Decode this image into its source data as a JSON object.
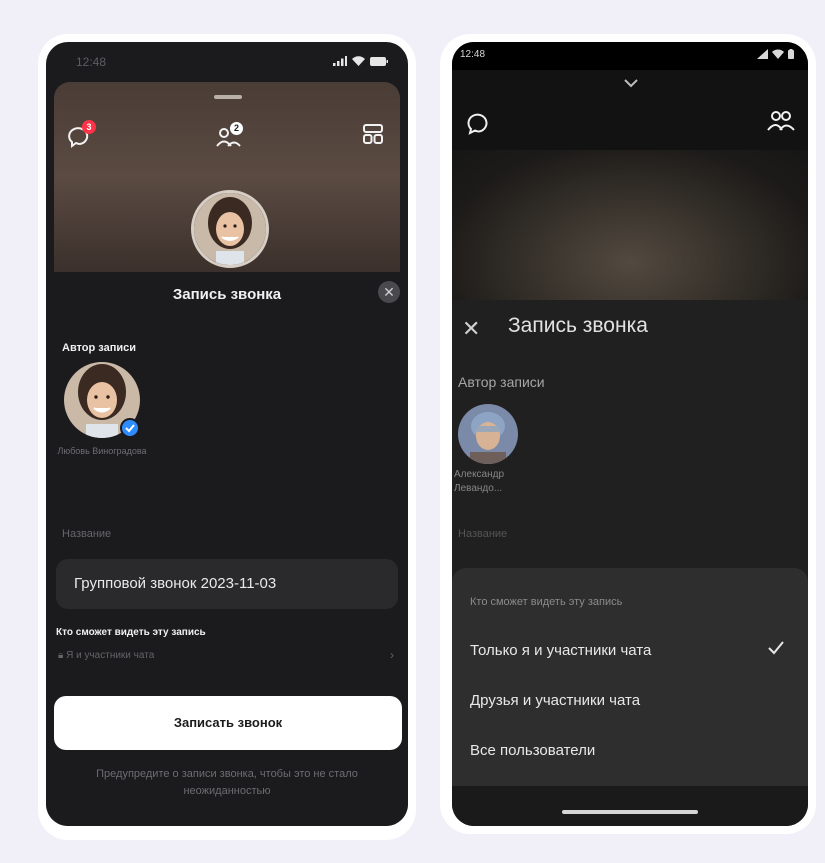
{
  "left_phone": {
    "status_time": "12:48",
    "chat_badge": "3",
    "participants_badge": "2",
    "sheet_title": "Запись звонка",
    "author_label": "Автор записи",
    "author_name": "Любовь Виноградова",
    "name_label": "Название",
    "name_value": "Групповой звонок 2023-11-03",
    "visibility_label": "Кто сможет видеть эту запись",
    "visibility_value": "Я и участники чата",
    "record_button": "Записать звонок",
    "hint": "Предупредите о записи звонка, чтобы это не стало неожиданностью"
  },
  "right_phone": {
    "status_time": "12:48",
    "sheet_title": "Запись звонка",
    "author_label": "Автор записи",
    "author_name_line1": "Александр",
    "author_name_line2": "Левандо...",
    "name_label": "Название",
    "visibility_title": "Кто сможет видеть эту запись",
    "options": [
      "Только я и участники чата",
      "Друзья и участники чата",
      "Все пользователи"
    ],
    "selected_option": "Только я и участники чата"
  },
  "colors": {
    "accent_blue": "#2f8cff",
    "badge_red": "#ff3347",
    "background": "#f1eff8"
  }
}
